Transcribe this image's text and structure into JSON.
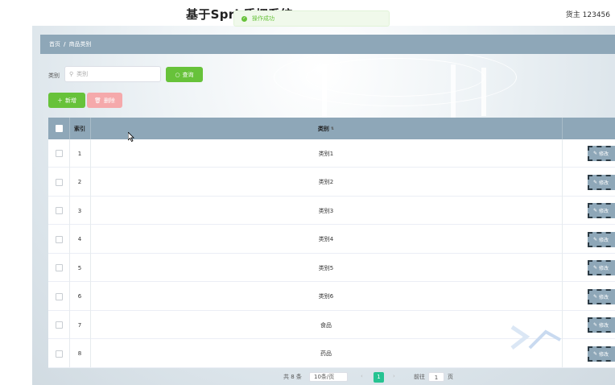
{
  "app": {
    "title": "基于Spri                    质押系统",
    "user": "货主 123456"
  },
  "toast": {
    "message": "操作成功"
  },
  "breadcrumb": {
    "home": "首页",
    "separator": "/",
    "current": "商品类别"
  },
  "search": {
    "label": "类别",
    "placeholder": "类别",
    "query_label": "查询"
  },
  "actions": {
    "add_label": "新增",
    "delete_label": "删除"
  },
  "table": {
    "columns": {
      "index": "索引",
      "category": "类别"
    },
    "edit_label": "修改",
    "rows": [
      {
        "index": "1",
        "category": "类别1"
      },
      {
        "index": "2",
        "category": "类别2"
      },
      {
        "index": "3",
        "category": "类别3"
      },
      {
        "index": "4",
        "category": "类别4"
      },
      {
        "index": "5",
        "category": "类别5"
      },
      {
        "index": "6",
        "category": "类别6"
      },
      {
        "index": "7",
        "category": "食品"
      },
      {
        "index": "8",
        "category": "药品"
      }
    ]
  },
  "pagination": {
    "total": "共 8 条",
    "page_size": "10条/页",
    "current_page": "1",
    "goto_label": "前往",
    "goto_value": "1",
    "page_suffix": "页"
  },
  "colors": {
    "header": "#8ea7b8",
    "success": "#67c23a",
    "danger_light": "#f5a9ab",
    "page_active": "#26c391"
  }
}
